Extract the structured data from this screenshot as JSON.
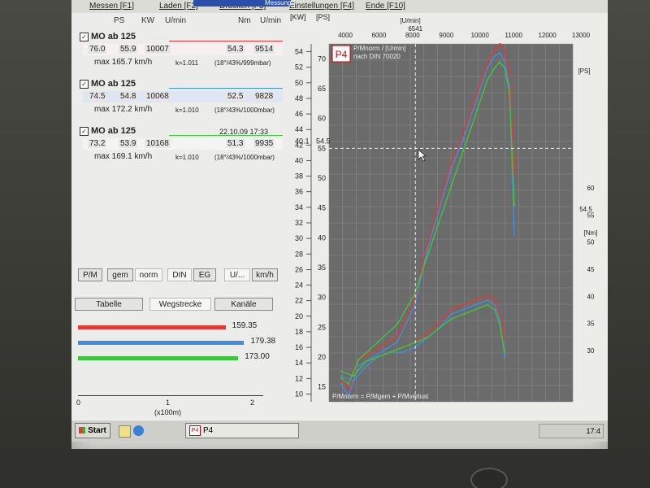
{
  "menu": {
    "messen": "Messen [F1]",
    "laden": "Laden [F2]",
    "drucken": "Drucken [F3]",
    "einstellungen": "Einstellungen [F4]",
    "ende": "Ende [F10]",
    "title_fragment": "Messung"
  },
  "header": {
    "ps": "PS",
    "kw": "KW",
    "umin": "U/min",
    "nm": "Nm",
    "umin2": "U/min"
  },
  "runs": [
    {
      "name": "MO ab 125",
      "timestamp": "",
      "ps": "76.0",
      "kw": "55.9",
      "rpm": "10007",
      "nm": "54.3",
      "nm_rpm": "9514",
      "max": "max 165.7 km/h",
      "k": "k=1.011",
      "cond": "(18°/43%/999mbar)",
      "color": "#e53935"
    },
    {
      "name": "MO ab 125",
      "timestamp": "",
      "ps": "74.5",
      "kw": "54.8",
      "rpm": "10068",
      "nm": "52.5",
      "nm_rpm": "9828",
      "max": "max 172.2 km/h",
      "k": "k=1.010",
      "cond": "(18°/43%/1000mbar)",
      "color": "#3d8fe0"
    },
    {
      "name": "MO ab 125",
      "timestamp": "22.10.09 17:33",
      "ps": "73.2",
      "kw": "53.9",
      "rpm": "10168",
      "nm": "51.3",
      "nm_rpm": "9935",
      "max": "max 169.1 km/h",
      "k": "k=1.010",
      "cond": "(18°/43%/1000mbar)",
      "color": "#3cc63c"
    }
  ],
  "buttons": {
    "pm": "P/M",
    "gem": "gem",
    "norm": "norm",
    "din": "DIN",
    "eg": "EG",
    "u": "U/...",
    "kmh": "km/h",
    "tabelle": "Tabelle",
    "wegstrecke": "Wegstrecke",
    "kanale": "Kanäle"
  },
  "distance_chart": {
    "bars": [
      {
        "value": 159.35,
        "label": "159.35",
        "color": "#e53935"
      },
      {
        "value": 179.38,
        "label": "179.38",
        "color": "#3d8fe0"
      },
      {
        "value": 173.0,
        "label": "173.00",
        "color": "#3cc63c"
      }
    ],
    "ticks": [
      "0",
      "1",
      "2"
    ],
    "unit": "(x100m)"
  },
  "chart_data": {
    "type": "line",
    "logo": "P4",
    "legend_title": "P/Mnorm / [U/min]",
    "legend_sub": "nach DIN 70020",
    "kw_unit": "[KW]",
    "ps_unit": "[PS]",
    "umin_unit": "[U/min]",
    "ps_unit_right": "[PS]",
    "nm_unit": "[Nm]",
    "kw_ticks": [
      "10",
      "12",
      "14",
      "16",
      "18",
      "20",
      "22",
      "24",
      "26",
      "28",
      "30",
      "32",
      "34",
      "36",
      "38",
      "40",
      "42",
      "44",
      "46",
      "48",
      "50",
      "52",
      "54"
    ],
    "ps_ticks": [
      "15",
      "20",
      "25",
      "30",
      "35",
      "40",
      "45",
      "50",
      "55",
      "60",
      "65",
      "70"
    ],
    "nm_ticks": [
      "30",
      "35",
      "40",
      "45",
      "50",
      "55",
      "60"
    ],
    "rpm_ticks": [
      "4000",
      "6000",
      "8000",
      "9000",
      "10000",
      "11000",
      "12000",
      "13000"
    ],
    "rpm_ticks_right": [
      "10000",
      "11000",
      "12000",
      "13000"
    ],
    "cursor": {
      "kw": "40.1",
      "ps": "54.5",
      "rpm": "6541",
      "ps_right": "54.5"
    },
    "xlim": [
      3000,
      13000
    ],
    "ps_lim": [
      12,
      72
    ],
    "nm_lim": [
      30,
      60
    ],
    "power_series": [
      {
        "name": "MO ab 125",
        "color": "#e53935",
        "x": [
          3500,
          3800,
          4200,
          5000,
          5800,
          6500,
          7000,
          7500,
          8000,
          8500,
          9000,
          9500,
          9800,
          10000,
          10200,
          10400,
          10600
        ],
        "y": [
          16,
          14,
          19,
          21,
          23,
          29,
          38,
          45,
          52,
          57,
          63,
          69,
          71,
          72,
          71,
          67,
          50
        ]
      },
      {
        "name": "MO ab 125",
        "color": "#3d8fe0",
        "x": [
          3500,
          3800,
          4200,
          5000,
          5800,
          6500,
          7000,
          7500,
          8000,
          8500,
          9000,
          9500,
          9800,
          10000,
          10200,
          10400,
          10600
        ],
        "y": [
          15,
          13,
          18,
          20,
          22,
          28,
          37,
          44,
          51,
          56,
          62,
          68,
          70,
          70.5,
          69,
          65,
          40
        ]
      },
      {
        "name": "MO ab 125",
        "color": "#3cc63c",
        "x": [
          3500,
          3800,
          4200,
          5000,
          5800,
          6500,
          7000,
          7500,
          8000,
          8500,
          9000,
          9500,
          9800,
          10000,
          10200,
          10400,
          10600
        ],
        "y": [
          16,
          15,
          19,
          22,
          25,
          30,
          36,
          42,
          48,
          54,
          60,
          66,
          68,
          69,
          68,
          64,
          45
        ]
      }
    ],
    "torque_series": [
      {
        "name": "MO ab 125",
        "color": "#e53935",
        "x": [
          3500,
          4000,
          4500,
          5000,
          5500,
          6000,
          6500,
          7000,
          7500,
          8000,
          8500,
          9000,
          9500,
          9800,
          10000,
          10200
        ],
        "y": [
          33,
          32,
          35,
          36,
          37,
          38,
          39,
          41,
          43,
          46,
          47,
          48,
          49,
          48,
          45,
          40
        ]
      },
      {
        "name": "MO ab 125",
        "color": "#3d8fe0",
        "x": [
          3500,
          4000,
          4500,
          5000,
          5500,
          6000,
          6500,
          7000,
          7500,
          8000,
          8500,
          9000,
          9500,
          9800,
          10000,
          10200
        ],
        "y": [
          32,
          31,
          34,
          36,
          37,
          37,
          38,
          40,
          42,
          45,
          46,
          47,
          48,
          47,
          44,
          36
        ]
      },
      {
        "name": "MO ab 125",
        "color": "#3cc63c",
        "x": [
          3500,
          4000,
          4500,
          5000,
          5500,
          6000,
          6500,
          7000,
          7500,
          8000,
          8500,
          9000,
          9500,
          9800,
          10000,
          10200
        ],
        "y": [
          33,
          32,
          35,
          36,
          37,
          38,
          39,
          40,
          42,
          44,
          45,
          46,
          47,
          46,
          43,
          37
        ]
      }
    ],
    "footer": "P/Mnorm = P/Mgem + P/Mverlust",
    "grid": true
  },
  "taskbar": {
    "start": "Start",
    "task": "P4",
    "clock": "17:4"
  }
}
